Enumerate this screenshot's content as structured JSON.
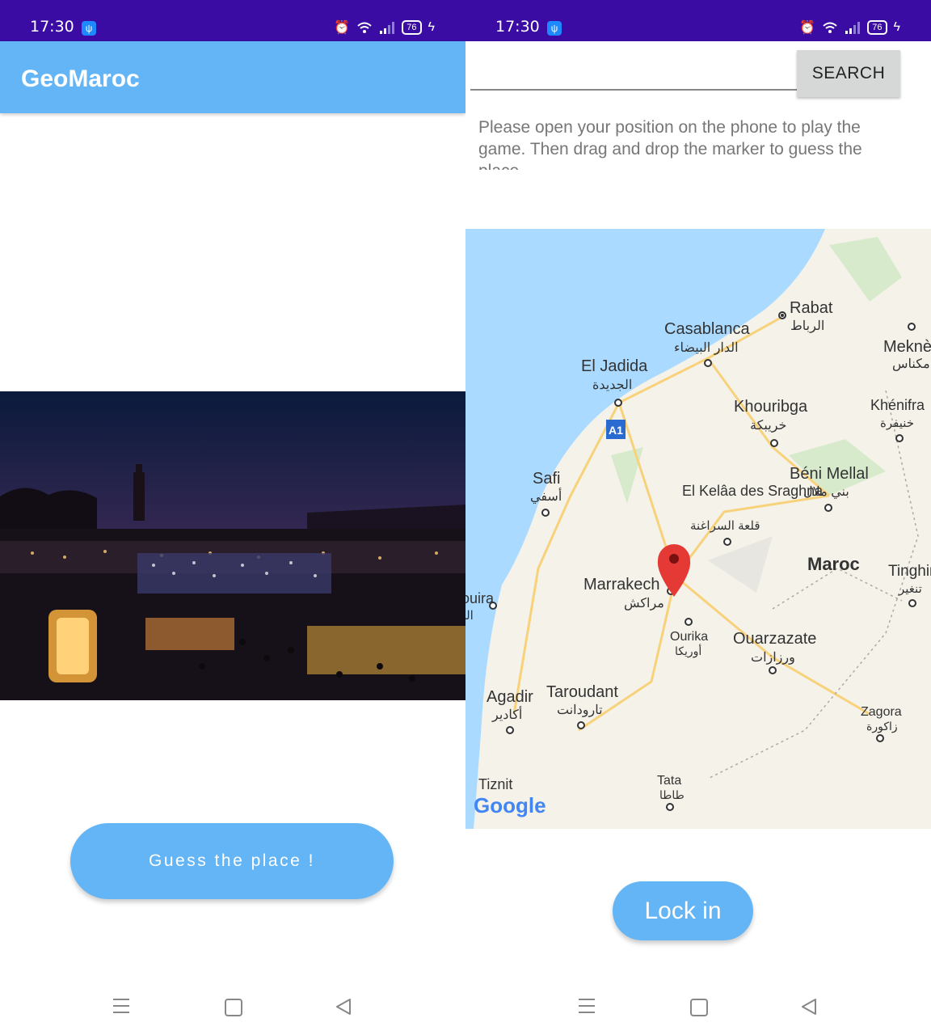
{
  "left": {
    "status": {
      "time": "17:30",
      "battery": "76"
    },
    "appbar": {
      "title": "GeoMaroc"
    },
    "guess_button": "Guess the place !"
  },
  "right": {
    "status": {
      "time": "17:30",
      "battery": "76"
    },
    "search": {
      "value": "",
      "button": "SEARCH"
    },
    "instructions": "Please open your position on the phone to play the game. Then drag and drop the marker to guess the place",
    "map": {
      "country": "Maroc",
      "places": [
        {
          "name": "Rabat",
          "arabic": "الرباط"
        },
        {
          "name": "Casablanca",
          "arabic": "الدار البيضاء"
        },
        {
          "name": "Meknès",
          "arabic": "مكناس"
        },
        {
          "name": "El Jadida",
          "arabic": "الجديدة"
        },
        {
          "name": "Khouribga",
          "arabic": "خريبكة"
        },
        {
          "name": "Khénifra",
          "arabic": "خنيفرة"
        },
        {
          "name": "Safi",
          "arabic": "أسفي"
        },
        {
          "name": "El Kelâa des Sraghna",
          "arabic": "قلعة السراغنة"
        },
        {
          "name": "Béni Mellal",
          "arabic": "بني ملال"
        },
        {
          "name": "Marrakech",
          "arabic": "مراكش"
        },
        {
          "name": "Tinghir",
          "arabic": "تنغير"
        },
        {
          "name": "Essaouira",
          "arabic": "الصويرة"
        },
        {
          "name": "Ourika",
          "arabic": "أوريكا"
        },
        {
          "name": "Ouarzazate",
          "arabic": "ورزازات"
        },
        {
          "name": "Agadir",
          "arabic": "أكادير"
        },
        {
          "name": "Taroudant",
          "arabic": "تارودانت"
        },
        {
          "name": "Zagora",
          "arabic": "زاكورة"
        },
        {
          "name": "Tiznit",
          "arabic": ""
        },
        {
          "name": "Tata",
          "arabic": "طاطا"
        }
      ],
      "highway": "A1",
      "logo": "Google"
    },
    "lock_button": "Lock in"
  },
  "icons": [
    "usb-icon",
    "alarm-icon",
    "wifi-icon",
    "signal-icon",
    "battery-icon",
    "charging-icon",
    "menu-nav-icon",
    "home-nav-icon",
    "back-nav-icon",
    "location-pin-icon"
  ]
}
